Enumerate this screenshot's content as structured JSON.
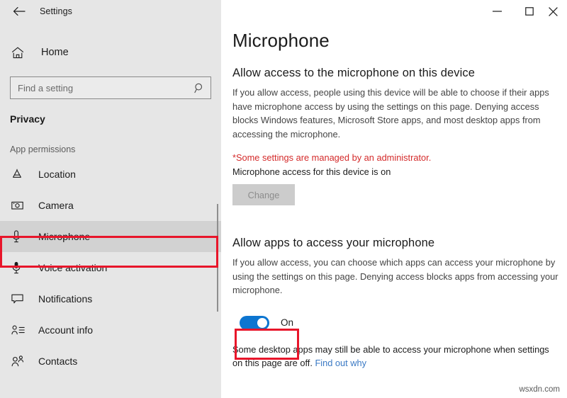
{
  "window": {
    "back_label": "back-arrow",
    "app_title": "Settings",
    "controls": {
      "minimize": "minimize-icon",
      "maximize": "maximize-icon",
      "close": "close-icon"
    }
  },
  "sidebar": {
    "home_label": "Home",
    "search": {
      "placeholder": "Find a setting",
      "value": "",
      "icon": "search-icon"
    },
    "section_title": "Privacy",
    "group_label": "App permissions",
    "items": [
      {
        "label": "Location",
        "icon": "location-icon",
        "selected": false
      },
      {
        "label": "Camera",
        "icon": "camera-icon",
        "selected": false
      },
      {
        "label": "Microphone",
        "icon": "microphone-icon",
        "selected": true
      },
      {
        "label": "Voice activation",
        "icon": "voice-activation-icon",
        "selected": false
      },
      {
        "label": "Notifications",
        "icon": "notifications-icon",
        "selected": false
      },
      {
        "label": "Account info",
        "icon": "account-info-icon",
        "selected": false
      },
      {
        "label": "Contacts",
        "icon": "contacts-icon",
        "selected": false
      }
    ]
  },
  "main": {
    "page_title": "Microphone",
    "device_section": {
      "heading": "Allow access to the microphone on this device",
      "description": "If you allow access, people using this device will be able to choose if their apps have microphone access by using the settings on this page. Denying access blocks Windows features, Microsoft Store apps, and most desktop apps from accessing the microphone.",
      "admin_note": "*Some settings are managed by an administrator.",
      "status": "Microphone access for this device is on",
      "change_button": "Change"
    },
    "apps_section": {
      "heading": "Allow apps to access your microphone",
      "description": "If you allow access, you can choose which apps can access your microphone by using the settings on this page. Denying access blocks apps from accessing your microphone.",
      "toggle_state": "On",
      "footer_text": "Some desktop apps may still be able to access your microphone when settings on this page are off.",
      "footer_link": "Find out why"
    }
  },
  "watermark": "wsxdn.com",
  "colors": {
    "accent": "#0c75d0",
    "annotation": "#e8152a",
    "warning_text": "#d42a2a",
    "link": "#3a79c4",
    "sidebar_bg": "#e6e6e6",
    "selected_bg": "#d2d2d2"
  }
}
